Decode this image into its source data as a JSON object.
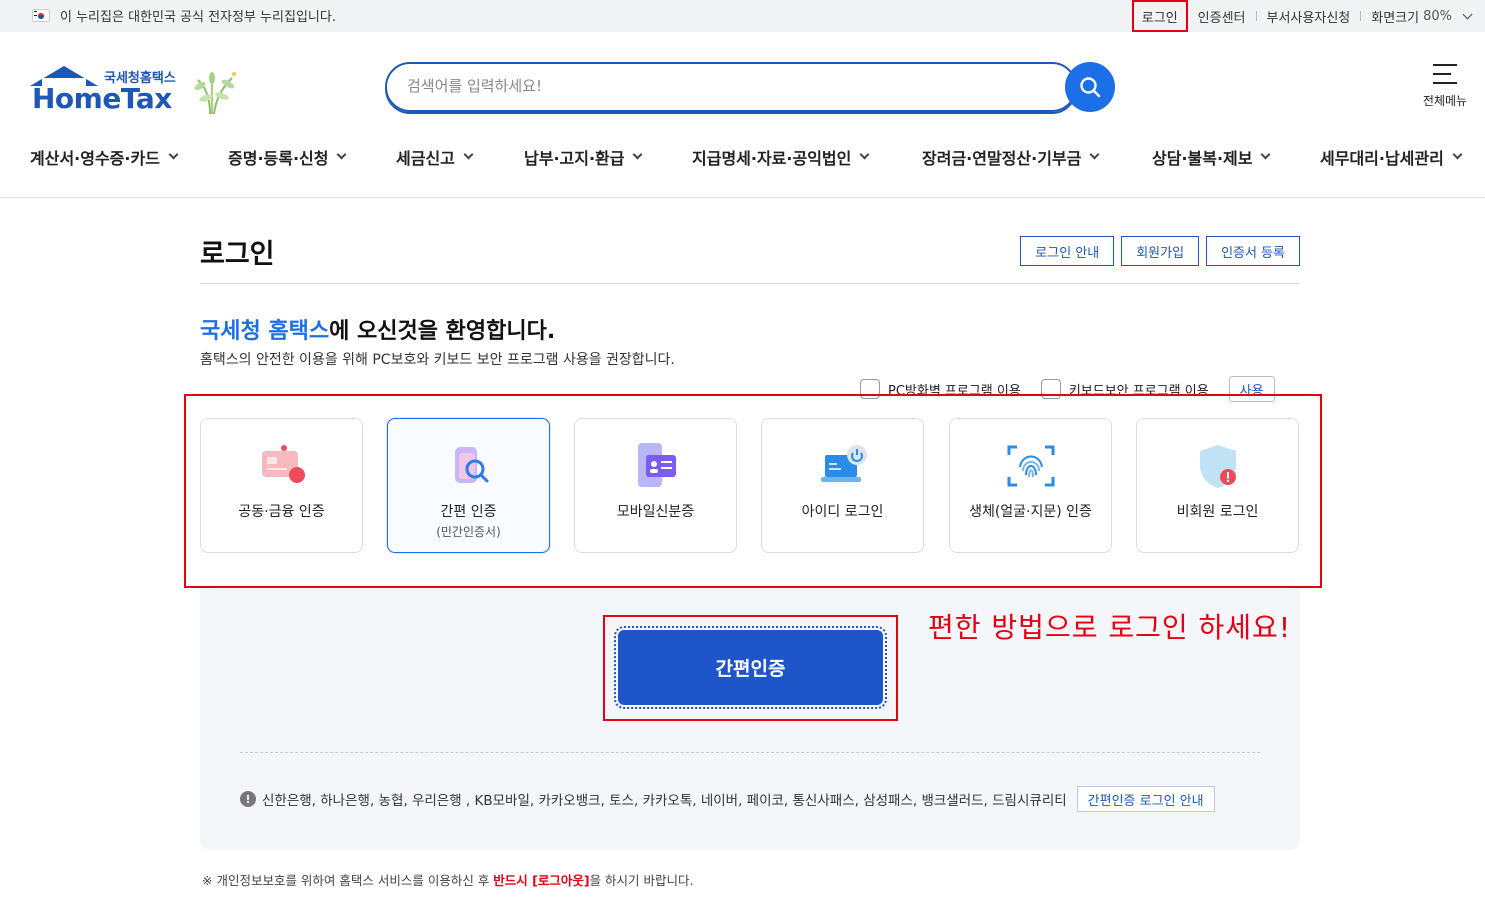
{
  "topbar": {
    "notice": "이 누리집은 대한민국 공식 전자정부 누리집입니다.",
    "login": "로그인",
    "cert_center": "인증센터",
    "dept_user": "부서사용자신청",
    "zoom_label": "화면크기",
    "zoom_value": "80%"
  },
  "header": {
    "logo_sub": "국세청홈택스",
    "logo_main": "HomeTax",
    "search_placeholder": "검색어를 입력하세요!",
    "all_menu": "전체메뉴"
  },
  "gnb": [
    "계산서·영수증·카드",
    "증명·등록·신청",
    "세금신고",
    "납부·고지·환급",
    "지급명세·자료·공익법인",
    "장려금·연말정산·기부금",
    "상담·불복·제보",
    "세무대리·납세관리"
  ],
  "main": {
    "title": "로그인",
    "buttons": [
      "로그인 안내",
      "회원가입",
      "인증서 등록"
    ],
    "welcome_hl": "국세청 홈택스",
    "welcome_rest": "에 오신것을 환영합니다.",
    "desc": "홈택스의 안전한 이용을 위해 PC보호와 키보드 보안 프로그램 사용을 권장합니다.",
    "opt_pc": "PC방화벽 프로그램 이용",
    "opt_kb": "키보드보안 프로그램 이용",
    "opt_use": "사용"
  },
  "cards": [
    {
      "label": "공동·금융 인증",
      "sub": "",
      "icon": "certificate-card-icon"
    },
    {
      "label": "간편 인증",
      "sub": "(민간인증서)",
      "icon": "simple-auth-search-icon"
    },
    {
      "label": "모바일신분증",
      "sub": "",
      "icon": "mobile-id-icon"
    },
    {
      "label": "아이디 로그인",
      "sub": "",
      "icon": "laptop-power-icon"
    },
    {
      "label": "생체(얼굴·지문) 인증",
      "sub": "",
      "icon": "fingerprint-icon"
    },
    {
      "label": "비회원 로그인",
      "sub": "",
      "icon": "shield-guest-icon"
    }
  ],
  "panel": {
    "main_button": "간편인증",
    "annotation": "편한 방법으로 로그인 하세요!",
    "providers": "신한은행, 하나은행, 농협, 우리은행 , KB모바일, 카카오뱅크, 토스, 카카오톡, 네이버, 페이코, 통신사패스, 삼성패스, 뱅크샐러드, 드림시큐리티",
    "guide_button": "간편인증 로그인 안내"
  },
  "footnote": {
    "pre": "※ 개인정보보호를 위하여 홈택스 서비스를 이용하신 후 ",
    "red": "반드시 [로그아웃]",
    "post": "을 하시기 바랍니다."
  },
  "colors": {
    "brand": "#1d58b8",
    "accent": "#1d6fe8",
    "button": "#1e56c9",
    "annotation_red": "#e60012"
  }
}
